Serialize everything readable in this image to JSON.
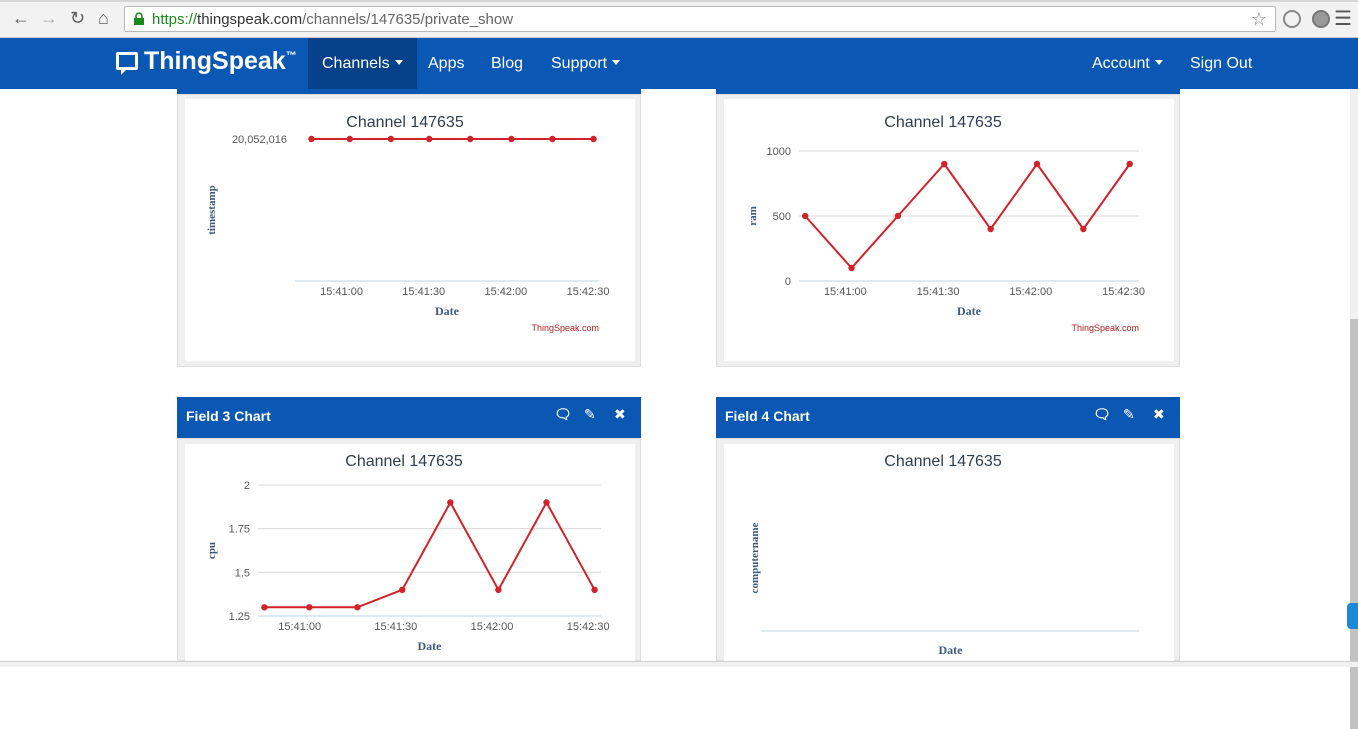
{
  "browser": {
    "url_scheme": "https://",
    "url_host": "thingspeak.com",
    "url_path": "/channels/147635/private_show"
  },
  "navbar": {
    "brand": "ThingSpeak",
    "brand_tm": "™",
    "items": [
      "Channels",
      "Apps",
      "Blog",
      "Support"
    ],
    "account": "Account",
    "signout": "Sign Out"
  },
  "panels": {
    "field3_title": "Field 3 Chart",
    "field4_title": "Field 4 Chart"
  },
  "colors": {
    "brand_blue": "#0a58b4",
    "series_red": "#d2232a"
  },
  "chart_data": [
    {
      "type": "line",
      "title": "Channel 147635",
      "xlabel": "Date",
      "ylabel": "timestamp",
      "credit": "ThingSpeak.com",
      "xticks": [
        "15:41:00",
        "15:41:30",
        "15:42:00",
        "15:42:30"
      ],
      "yticks": [
        "20,052,016"
      ],
      "x": [
        "15:40:49",
        "15:41:03",
        "15:41:18",
        "15:41:32",
        "15:41:47",
        "15:42:02",
        "15:42:17",
        "15:42:32"
      ],
      "values": [
        20052016,
        20052016,
        20052016,
        20052016,
        20052016,
        20052016,
        20052016,
        20052016
      ]
    },
    {
      "type": "line",
      "title": "Channel 147635",
      "xlabel": "Date",
      "ylabel": "ram",
      "credit": "ThingSpeak.com",
      "xticks": [
        "15:41:00",
        "15:41:30",
        "15:42:00",
        "15:42:30"
      ],
      "yticks": [
        "0",
        "500",
        "1000"
      ],
      "ylim": [
        0,
        1000
      ],
      "x": [
        "15:40:47",
        "15:41:02",
        "15:41:17",
        "15:41:32",
        "15:41:47",
        "15:42:02",
        "15:42:17",
        "15:42:32"
      ],
      "values": [
        500,
        100,
        500,
        900,
        400,
        900,
        400,
        900
      ]
    },
    {
      "type": "line",
      "title": "Channel 147635",
      "xlabel": "Date",
      "ylabel": "cpu",
      "xticks": [
        "15:41:00",
        "15:41:30",
        "15:42:00",
        "15:42:30"
      ],
      "yticks": [
        "1.25",
        "1.5",
        "1.75",
        "2"
      ],
      "ylim": [
        1.25,
        2
      ],
      "x": [
        "15:40:49",
        "15:41:03",
        "15:41:18",
        "15:41:32",
        "15:41:47",
        "15:42:02",
        "15:42:17",
        "15:42:32"
      ],
      "values": [
        1.3,
        1.3,
        1.3,
        1.4,
        1.9,
        1.4,
        1.9,
        1.4
      ]
    },
    {
      "type": "line",
      "title": "Channel 147635",
      "xlabel": "Date",
      "ylabel": "computername",
      "values": []
    }
  ]
}
